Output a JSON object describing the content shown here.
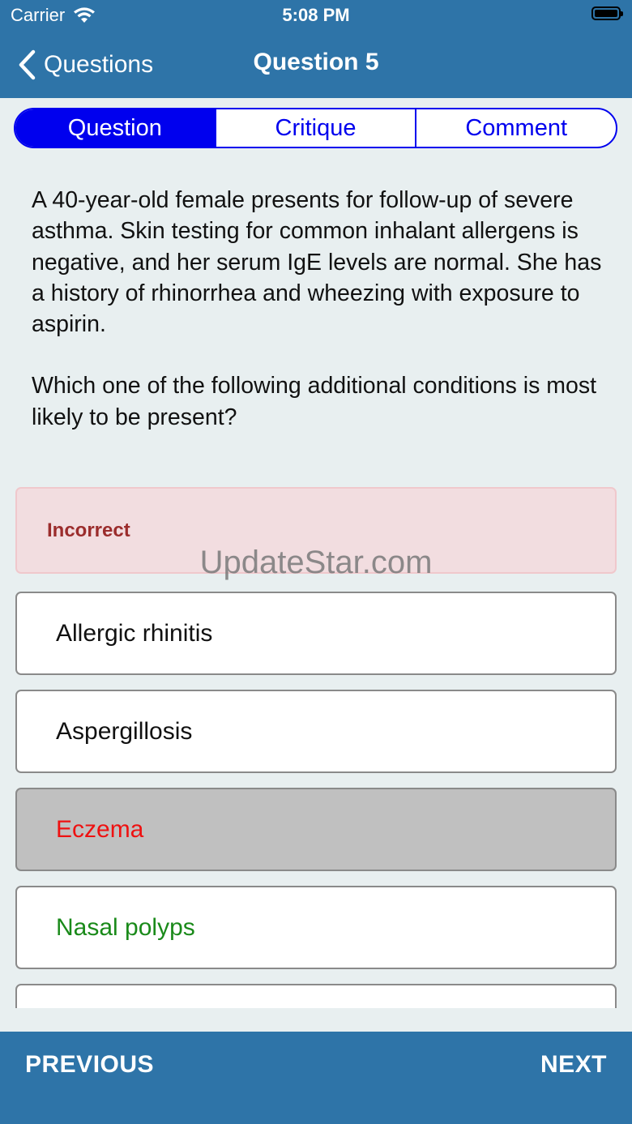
{
  "status_bar": {
    "carrier": "Carrier",
    "time": "5:08 PM"
  },
  "nav": {
    "back_label": "Questions",
    "title": "Question 5"
  },
  "tabs": [
    {
      "label": "Question",
      "active": true
    },
    {
      "label": "Critique",
      "active": false
    },
    {
      "label": "Comment",
      "active": false
    }
  ],
  "question": {
    "stem": "A 40-year-old female presents for follow-up of severe asthma. Skin testing for common inhalant allergens is negative, and her serum IgE levels are normal. She has a history of rhinorrhea and wheezing with exposure to aspirin.",
    "prompt": "Which one of the following additional conditions is most likely to be present?"
  },
  "feedback": {
    "label": "Incorrect"
  },
  "watermark": "UpdateStar.com",
  "options": [
    {
      "label": "Allergic rhinitis",
      "state": "default"
    },
    {
      "label": "Aspergillosis",
      "state": "default"
    },
    {
      "label": "Eczema",
      "state": "selected-incorrect"
    },
    {
      "label": "Nasal polyps",
      "state": "correct"
    }
  ],
  "bottom_bar": {
    "previous_label": "PREVIOUS",
    "next_label": "NEXT"
  },
  "colors": {
    "bar_blue": "#2e74a8",
    "tab_blue": "#0000ee",
    "incorrect_red": "#ee1111",
    "correct_green": "#1a8a1a",
    "feedback_bg": "#f2dde0"
  }
}
